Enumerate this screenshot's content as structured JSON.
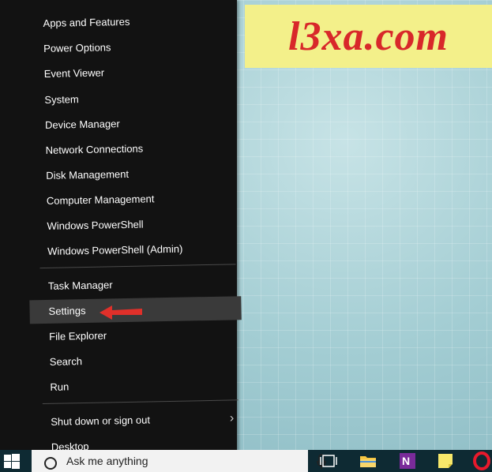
{
  "watermark": {
    "text": "l3xa.com"
  },
  "menu": {
    "items": [
      {
        "label": "Apps and Features"
      },
      {
        "label": "Power Options"
      },
      {
        "label": "Event Viewer"
      },
      {
        "label": "System"
      },
      {
        "label": "Device Manager"
      },
      {
        "label": "Network Connections"
      },
      {
        "label": "Disk Management"
      },
      {
        "label": "Computer Management"
      },
      {
        "label": "Windows PowerShell"
      },
      {
        "label": "Windows PowerShell (Admin)"
      },
      {
        "label": "Task Manager"
      },
      {
        "label": "Settings"
      },
      {
        "label": "File Explorer"
      },
      {
        "label": "Search"
      },
      {
        "label": "Run"
      },
      {
        "label": "Shut down or sign out"
      },
      {
        "label": "Desktop"
      }
    ]
  },
  "taskbar": {
    "search_placeholder": "Ask me anything",
    "icons": [
      "windows-icon",
      "cortana-icon",
      "microphone-icon",
      "task-view-icon",
      "file-explorer-icon",
      "onenote-icon",
      "sticky-notes-icon",
      "opera-icon"
    ]
  },
  "colors": {
    "menu_bg": "#121212",
    "hover_bg": "#3a3a3a",
    "arrow": "#e0302a",
    "watermark_bg": "#f3f08a",
    "watermark_text": "#d8282a"
  }
}
